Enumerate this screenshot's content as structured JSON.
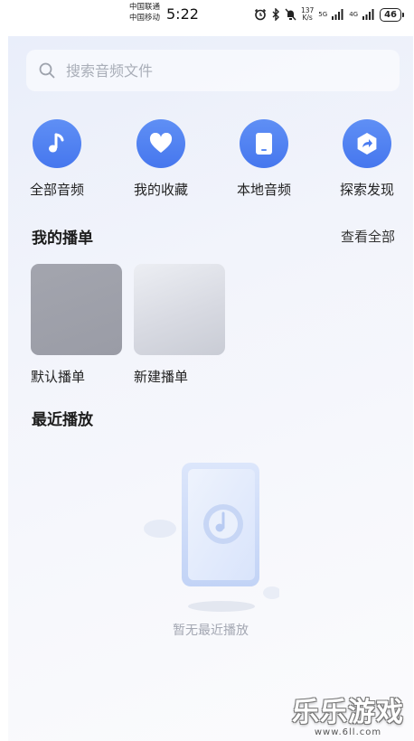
{
  "status_bar": {
    "carrier_1": "中国联通",
    "carrier_2": "中国移动",
    "time": "5:22",
    "net_speed_value": "137",
    "net_speed_unit": "K/s",
    "signal_1": "5G",
    "signal_2": "4G",
    "battery": "46"
  },
  "search": {
    "placeholder": "搜索音频文件",
    "value": ""
  },
  "quick_actions": [
    {
      "label": "全部音频",
      "icon": "music-note-icon"
    },
    {
      "label": "我的收藏",
      "icon": "heart-icon"
    },
    {
      "label": "本地音频",
      "icon": "phone-icon"
    },
    {
      "label": "探索发现",
      "icon": "share-arrow-icon"
    }
  ],
  "playlists": {
    "title": "我的播单",
    "see_all": "查看全部",
    "items": [
      {
        "label": "默认播单"
      },
      {
        "label": "新建播单"
      }
    ]
  },
  "recent": {
    "title": "最近播放",
    "empty_text": "暂无最近播放"
  },
  "watermark": {
    "main": "乐乐游戏",
    "sub": "www.6ll.com"
  },
  "colors": {
    "accent": "#4a7cf0",
    "background_top": "#e9eefa"
  }
}
